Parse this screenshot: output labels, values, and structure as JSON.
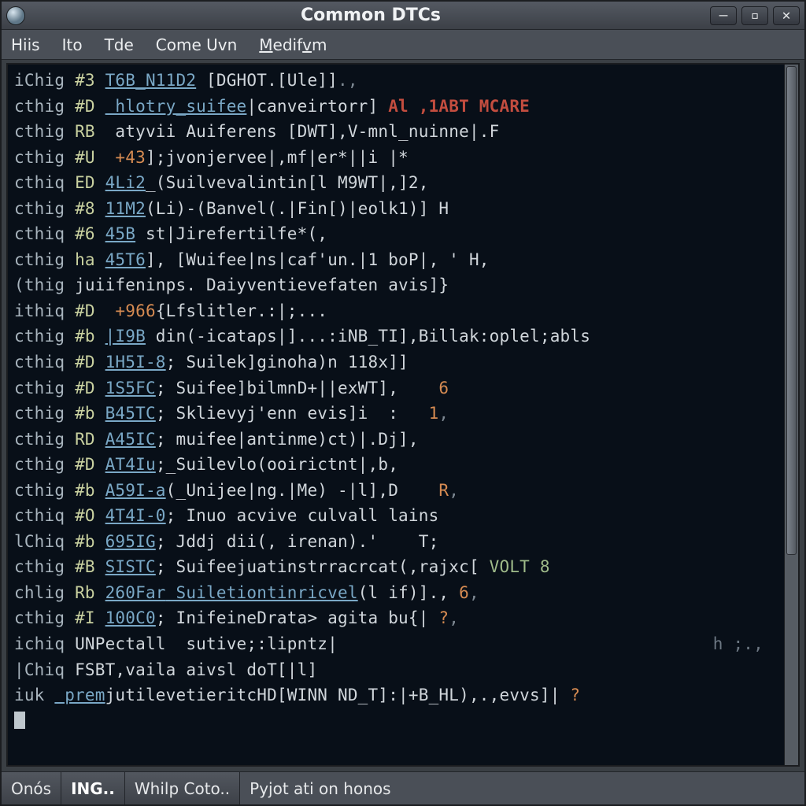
{
  "window": {
    "title": "Common DTCs"
  },
  "menu": {
    "items": [
      "Hiis",
      "Ito",
      "Tde",
      "Come Uvn",
      "Medifvm"
    ]
  },
  "palette": {
    "bg_terminal": "#080f18",
    "fg_default": "#b9c2c9",
    "keyword": "#a8b4bd",
    "code": "#c9d1a0",
    "ident_underline": "#7aa8c6",
    "literal": "#d68b52",
    "string": "#9fbb8a",
    "comment": "#6c7782",
    "warn": "#c34d3f",
    "punct": "#7e8993",
    "chrome_bg": "#4a4f57",
    "chrome_dark": "#3a3f44"
  },
  "terminal": {
    "lines": [
      {
        "kw": "iChig",
        "tag": "#3",
        "code": "T6B_N11D2",
        "body": " [DGHOT.[Ule]]",
        "tail": ".,"
      },
      {
        "kw": "cthig",
        "tag": "#D",
        "ident": "hlotry_suifee",
        "body": "|canveirtorr]",
        "warn": "Al ,1ABT MCARE"
      },
      {
        "kw": "cthig",
        "tag": "RB",
        "body": " atyvii Auiferens [DWT],V-mnl_nuinne|.F"
      },
      {
        "kw": "cthig",
        "tag": "#U",
        "lit": "+43",
        "body": "];jvonjervee|,mf|er*||i |*"
      },
      {
        "kw": "cthiq",
        "tag": "ED",
        "code": "4Li2",
        "body": "_(Suilvevalintin[l M9WT|,]2,"
      },
      {
        "kw": "cthig",
        "tag": "#8",
        "code": "11M2",
        "body": "(Li)-(Banvel(.|Fin[)|eolk1)] H"
      },
      {
        "kw": "cthiq",
        "tag": "#6",
        "code": "45B",
        "body": " st|Jirefertilfe*(,"
      },
      {
        "kw": "cthig",
        "tag": "ha",
        "code": "45T6",
        "body": "], [Wuifee|ns|caf'un.|1 boP|, ' H,"
      },
      {
        "kw": "(thig",
        "body": "juiifeninps. Daiyventievefaten avis]}"
      },
      {
        "kw": "ithiq",
        "tag": "#D",
        "lit": "+966",
        "body": "{Lfslitler.:|;..."
      },
      {
        "kw": "cthig",
        "tag": "#b",
        "code": "|I9B",
        "body": " din(-icataρs|]...:iNB_TI],Billak:oplel;abls"
      },
      {
        "kw": "cthiq",
        "tag": "#D",
        "code": "1H5I-8",
        "body": "; Suilek]ginoha)n 118x]]"
      },
      {
        "kw": "cthig",
        "tag": "#D",
        "code": "1S5FC",
        "body": "; Suifee]bilmnD+||exWT],   ",
        "lit2": "6"
      },
      {
        "kw": "cthig",
        "tag": "#b",
        "code": "B45TC",
        "body": "; Sklievyj'enn evis]i  :  ",
        "lit2": "1",
        ",": ","
      },
      {
        "kw": "cthig",
        "tag": "RD",
        "code": "A45IC",
        "body": "; muifee|antinme)ct)|.Dj],"
      },
      {
        "kw": "cthig",
        "tag": "#D",
        "code": "AT4Iu",
        "body": ";_Suilevlo(ooirictnt|,b,"
      },
      {
        "kw": "cthig",
        "tag": "#b",
        "code": "A59I-a",
        "body": "(_Unijee|ng.|Me) -|l],D   ",
        "lit2": "R",
        ",": ","
      },
      {
        "kw": "cthiq",
        "tag": "#O",
        "code": "4T4I-0",
        "body": "; Inuo acvive culvall lains"
      },
      {
        "kw": "lChiq",
        "tag": "#b",
        "code": "695IG",
        "body": "; Jddj dii(, irenan).'    T;"
      },
      {
        "kw": "cthig",
        "tag": "#B",
        "code": "SISTC",
        "body": "; Suifeejuatinstrracrcat(,rajxc[ ",
        "warn2": "VOLT 8"
      },
      {
        "kw": "chlig",
        "tag": "Rb",
        "code": "260Far",
        "ident": "Suiletiontinricvel",
        "body": "(l if)].,",
        "lit2": "6",
        ",": ","
      },
      {
        "kw": "cthig",
        "tag": "#I",
        "code": "100C0",
        "body": "; InifeineDrata> agita bu{|",
        "lit2": "?",
        ",": ","
      },
      {
        "kw": "ichiq",
        "body2": "UNPectall  sutive;:lipntz|",
        "accent": "h ;.,"
      },
      {
        "kw": "|Chiq",
        "body2": "FSBT,vaila aivsl doT[|l]"
      },
      {
        "kw": "iuk",
        "ident": "prem",
        "body": "jutilevetieritcHD[WINN ND_T]:|+B_HL),.,evvs]|",
        "lit2": "?"
      }
    ]
  },
  "status": {
    "tabs": [
      "Onós",
      "ING..",
      "Whilp Coto.."
    ],
    "active_tab_index": 1,
    "right_text": "Pyjot ati on honos"
  }
}
